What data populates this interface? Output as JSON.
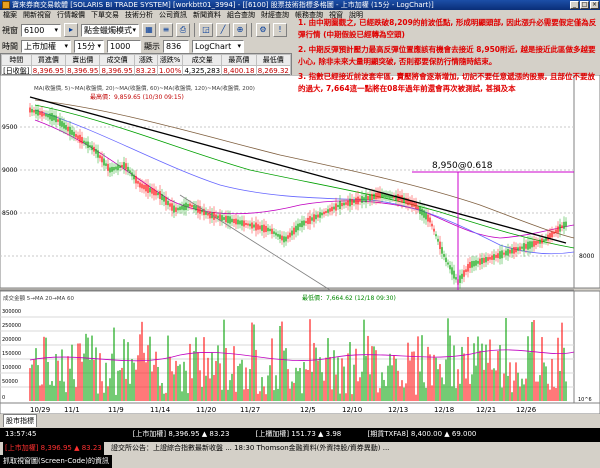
{
  "window": {
    "title": "寶來券商交易軟體 [SOLARIS BI TRADE SYSTEM] [workbtt01_3994] - [[6100] 股票技術指標多格圖 - 上市加權 (15分 - LogChart)]",
    "controls": [
      "_",
      "□",
      "×"
    ]
  },
  "menu": [
    "檔案",
    "開新視窗",
    "行情報價",
    "下單交易",
    "技術分析",
    "公司資訊",
    "新聞資料",
    "組合查詢",
    "財經查詢",
    "帳務查詢",
    "視窗",
    "說明"
  ],
  "toolbar": {
    "code_label": "視窗",
    "code_value": "6100",
    "layout_select": "點金蠟燭模式",
    "symbol_value": "上市加權",
    "period_value": "15分",
    "count_value": "1000",
    "zoom_label": "顯示",
    "zoom_value": "836",
    "row3_left": "時間",
    "row3_right": "LogChart"
  },
  "quote_table": {
    "headers": [
      "時間",
      "買進價",
      "賣出價",
      "成交價",
      "漲跌",
      "漲跌%",
      "成交量",
      "最高價",
      "最低價"
    ],
    "values": [
      "[日收盤]",
      "8,396.95",
      "8,396.95",
      "8,396.95",
      "83.23",
      "1.00%",
      "4,325,283",
      "8,400.18",
      "8,269.32"
    ]
  },
  "chart": {
    "ma_legend": "MA(收盤價, 5)~MA(收盤價, 20)~MA(收盤價, 60)~MA(收盤價, 120)~MA(收盤價, 200)",
    "high_label": "最高價：9,859.65 (10/30 09:15)",
    "low_label": "最低價：7,664.62 (12/18 09:30)",
    "fib_label": "8,950@0.618",
    "y_ticks": [
      "9500",
      "9000",
      "8500",
      "8000"
    ],
    "x_ticks": [
      "10/29",
      "11/1",
      "11/9",
      "11/14",
      "11/20",
      "11/27",
      "12/5",
      "12/10",
      "12/13",
      "12/18",
      "12/21",
      "12/26"
    ],
    "volume_legend": "成交金額   5→MA 20→MA 60",
    "volume_ticks": [
      "300000",
      "250000",
      "200000",
      "150000",
      "100000",
      "50000",
      "0"
    ],
    "volume_unit": "10^6"
  },
  "annotation": {
    "p1": "1. 由中期圖觀之, 已經跌破8,209的前波低點, 形成明顯頭部, 因此漲升必需要假定僅為反彈行情 (中期假設已經轉為空頭)",
    "p2": "2. 中期反彈預計壓力最高反彈位置應該有機會去接近 8,950附近, 越是接近此區做多越要小心, 除非未來大量明顯突破, 否則都要保防行情隨時結束。",
    "p3": "3. 指數已經接近前波套牢區, 賣壓將會逐漸增加, 切記不要任意遞漲的股票, 且部位不要放的過大, 7,664這一點將在08年過年前還會再次被測試, 甚損及本"
  },
  "status": {
    "tab_label": "股市指標",
    "time_text": "13:57:45",
    "quote_a": "[上市加權] 8,396.95 ▲ 83.23",
    "quote_b": "[上櫃加權] 151.73 ▲ 3.98",
    "quote_c": "[期貨TXFA8] 8,400.00 ▲ 69.000",
    "quote_d": "[上市加權] 8,396.95 ▲ 83.23",
    "news_text": "證交所公告：上證綜合指數最新收盤 ...  18:30 Thomson金融資料(外資持股/資券異動) ...",
    "taskbar": "抓取視窗圖(Screen-Code)的資訊"
  },
  "colors": {
    "trend": "#000000",
    "fib": "#cc00cc",
    "annotation": "#e00000",
    "up_bar": "#ff2020",
    "down_bar": "#18a818",
    "ma5": "#ff6666",
    "ma20": "#c000c0",
    "ma60": "#6666ff",
    "ma120": "#00a000",
    "ma200": "#806040"
  }
}
